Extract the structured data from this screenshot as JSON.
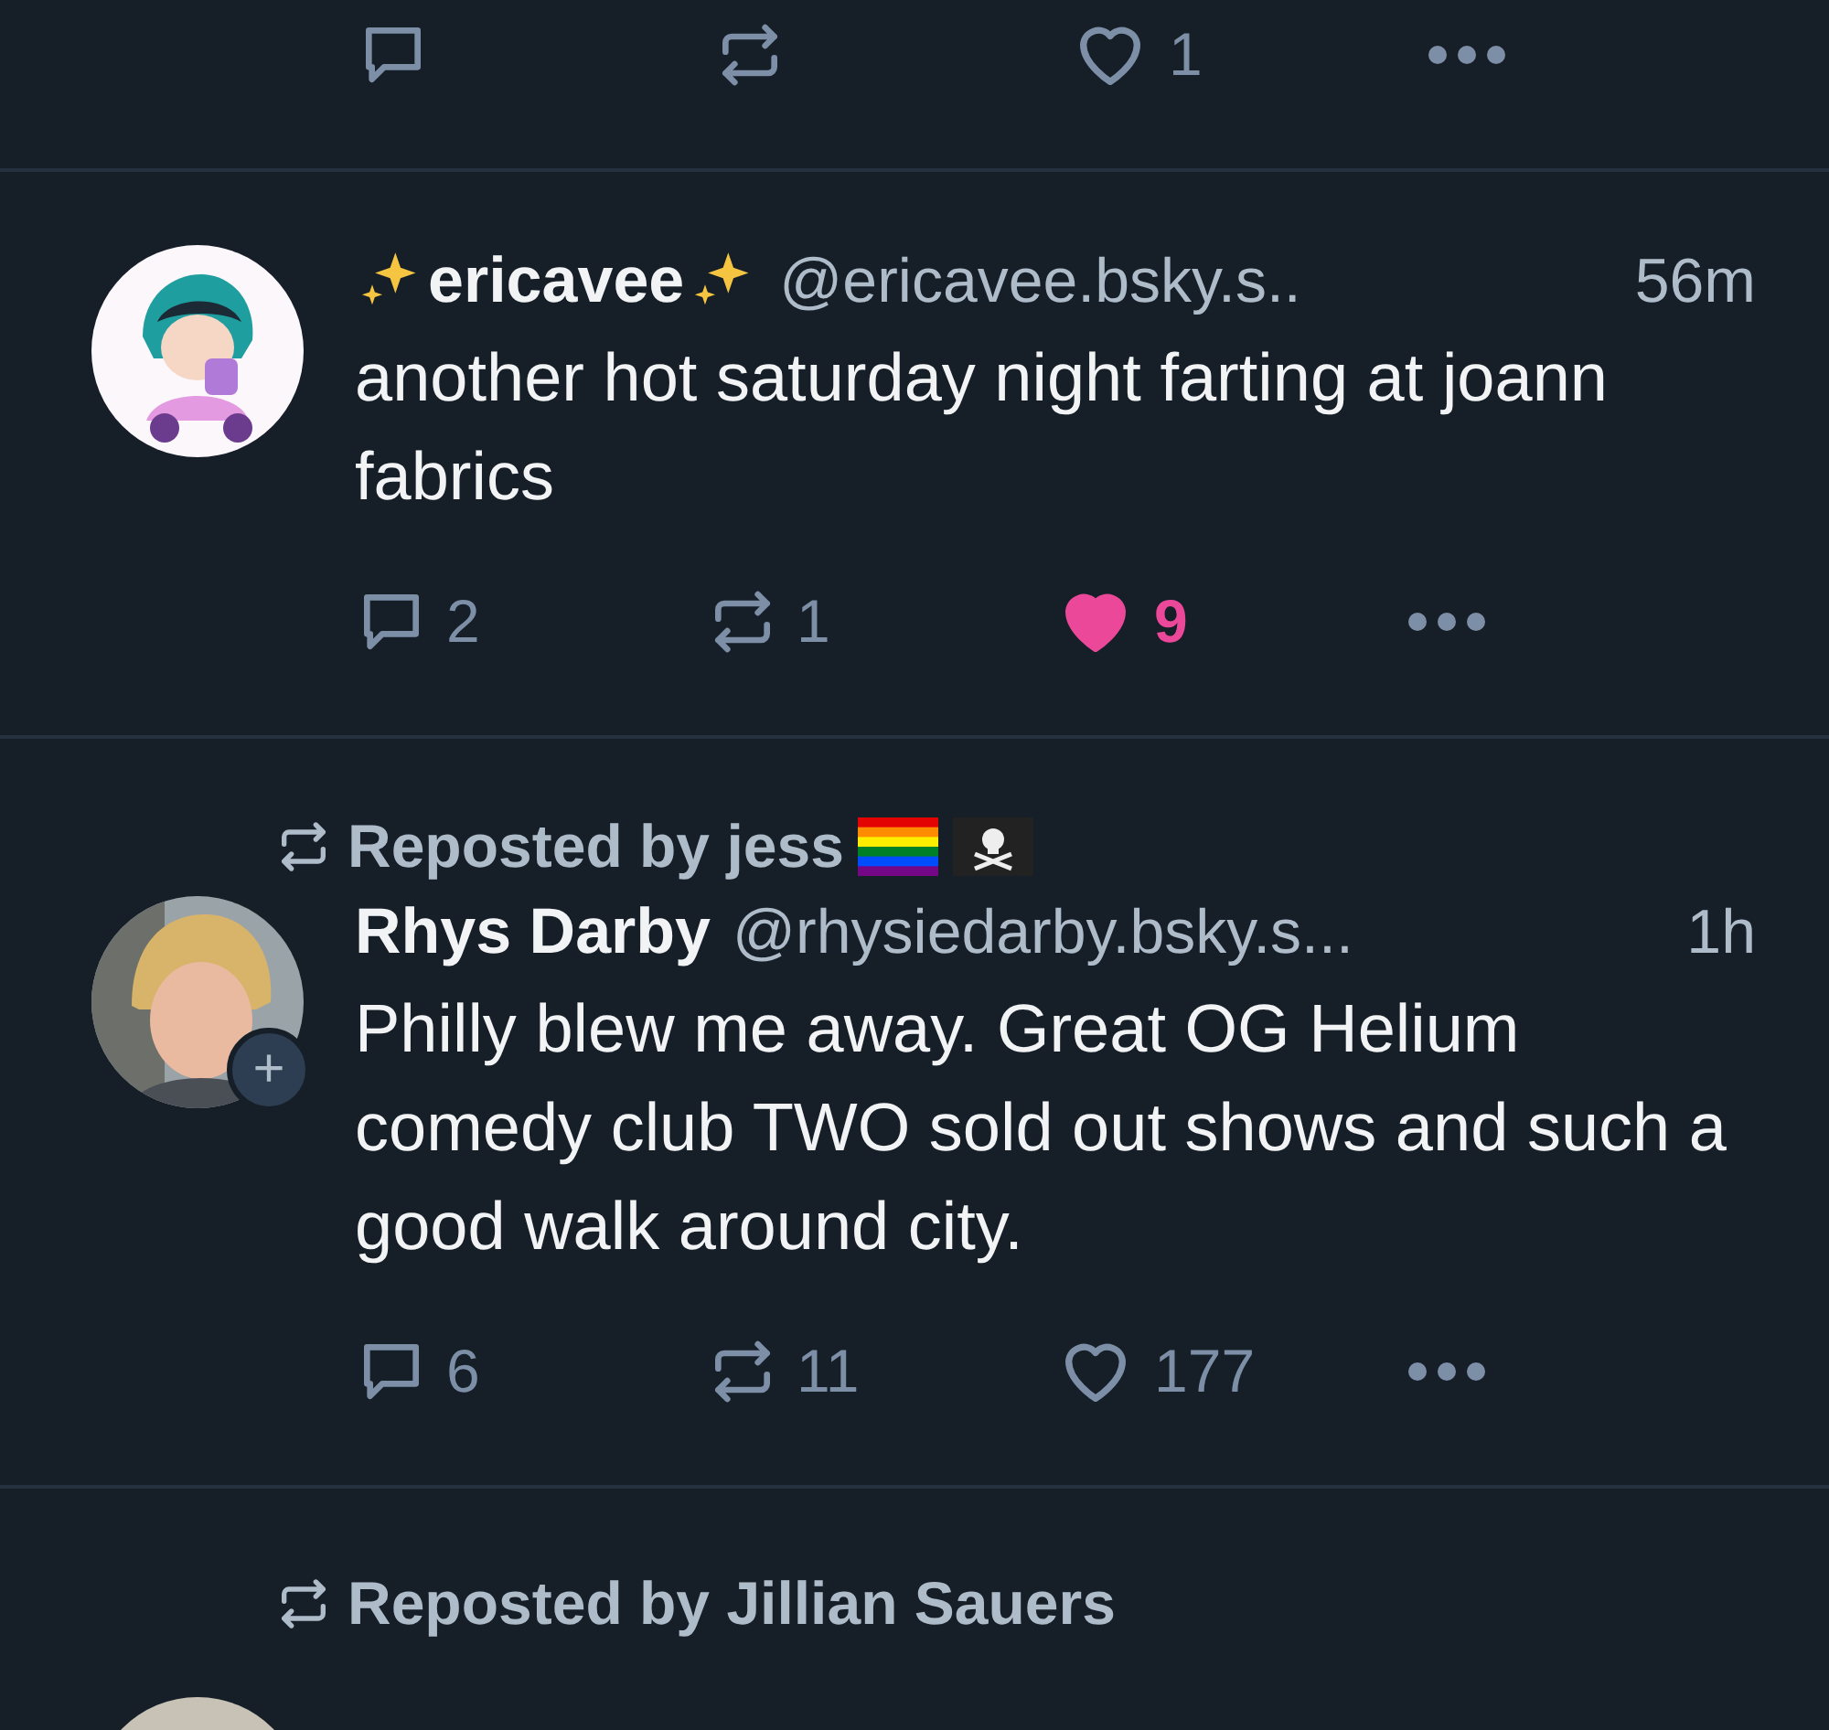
{
  "posts": [
    {
      "kind": "actions_only",
      "actions": {
        "likes": "1",
        "liked": false
      }
    },
    {
      "kind": "full",
      "author": {
        "name": "ericavee",
        "sparkles": true,
        "handle": "@ericavee.bsky.s..",
        "time": "56m"
      },
      "text": "another hot saturday night farting at joann fabrics",
      "actions": {
        "replies": "2",
        "reposts": "1",
        "likes": "9",
        "liked": true
      }
    },
    {
      "kind": "full",
      "reposted_by": {
        "label": "Reposted by jess",
        "flags": true
      },
      "author": {
        "name": "Rhys Darby",
        "sparkles": false,
        "handle": "@rhysiedarby.bsky.s...",
        "time": "1h",
        "follow_badge": "+"
      },
      "text": "Philly blew me away. Great OG Helium comedy club TWO sold out shows and such a good walk around city.",
      "actions": {
        "replies": "6",
        "reposts": "11",
        "likes": "177",
        "liked": false
      }
    },
    {
      "kind": "header_only",
      "reposted_by": {
        "label": "Reposted by Jillian Sauers",
        "flags": false
      }
    }
  ]
}
